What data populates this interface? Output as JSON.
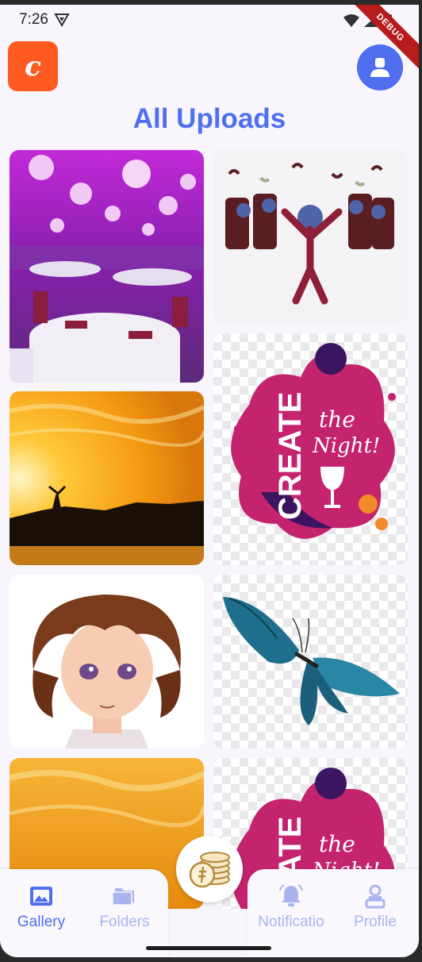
{
  "status_bar": {
    "time": "7:26",
    "debug_label": "DEBUG"
  },
  "header": {
    "logo_letter": "c",
    "title": "All Uploads"
  },
  "gallery": {
    "items": [
      {
        "subject": "banquet hall with purple lighting"
      },
      {
        "subject": "party crowd pictogram"
      },
      {
        "subject": "sunset over lake"
      },
      {
        "subject": "Create the Night splash graphic"
      },
      {
        "subject": "anime boy portrait"
      },
      {
        "subject": "blue butterfly"
      },
      {
        "subject": "sunset sky"
      },
      {
        "subject": "Create the Night splash graphic"
      }
    ]
  },
  "bottom_nav": {
    "items": [
      {
        "label": "Gallery",
        "icon": "gallery-icon",
        "active": true
      },
      {
        "label": "Folders",
        "icon": "folder-icon",
        "active": false
      },
      {
        "label": "Notificatio",
        "icon": "bell-icon",
        "active": false
      },
      {
        "label": "Profile",
        "icon": "person-icon",
        "active": false
      }
    ],
    "fab_icon": "coins-icon"
  },
  "colors": {
    "accent": "#4f6ef0",
    "logo": "#ff5a1f",
    "inactive": "#a9b4f0",
    "background": "#f8f5fc"
  },
  "art_text": {
    "create": "CREATE",
    "the": "the",
    "night": "Night!"
  }
}
